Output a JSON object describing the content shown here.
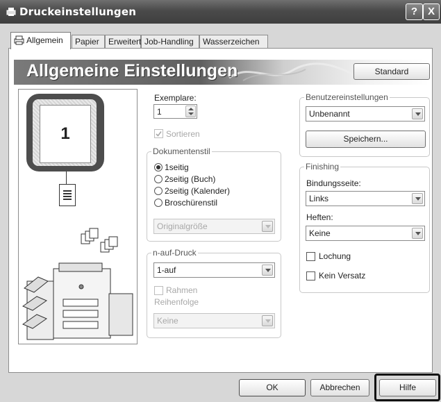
{
  "window": {
    "title": "Druckeinstellungen",
    "help_btn": "?",
    "close_btn": "X"
  },
  "tabs": [
    "Allgemein",
    "Papier",
    "Erweitert",
    "Job-Handling",
    "Wasserzeichen"
  ],
  "banner": {
    "title": "Allgemeine Einstellungen",
    "standard_btn": "Standard"
  },
  "preview": {
    "page_number": "1"
  },
  "copies": {
    "label": "Exemplare:",
    "value": "1",
    "collate_label": "Sortieren",
    "collate_checked": true
  },
  "document_style": {
    "title": "Dokumentenstil",
    "options": [
      "1seitig",
      "2seitig (Buch)",
      "2seitig (Kalender)",
      "Broschürenstil"
    ],
    "selected": 0,
    "size_select": "Originalgröße"
  },
  "nup": {
    "title": "n-auf-Druck",
    "value": "1-auf",
    "border_label": "Rahmen",
    "order_label": "Reihenfolge",
    "order_value": "Keine"
  },
  "user_settings": {
    "title": "Benutzereinstellungen",
    "value": "Unbenannt",
    "save_btn": "Speichern..."
  },
  "finishing": {
    "title": "Finishing",
    "binding_label": "Bindungsseite:",
    "binding_value": "Links",
    "staple_label": "Heften:",
    "staple_value": "Keine",
    "punch_label": "Lochung",
    "offset_label": "Kein Versatz"
  },
  "footer": {
    "ok": "OK",
    "cancel": "Abbrechen",
    "help": "Hilfe"
  }
}
